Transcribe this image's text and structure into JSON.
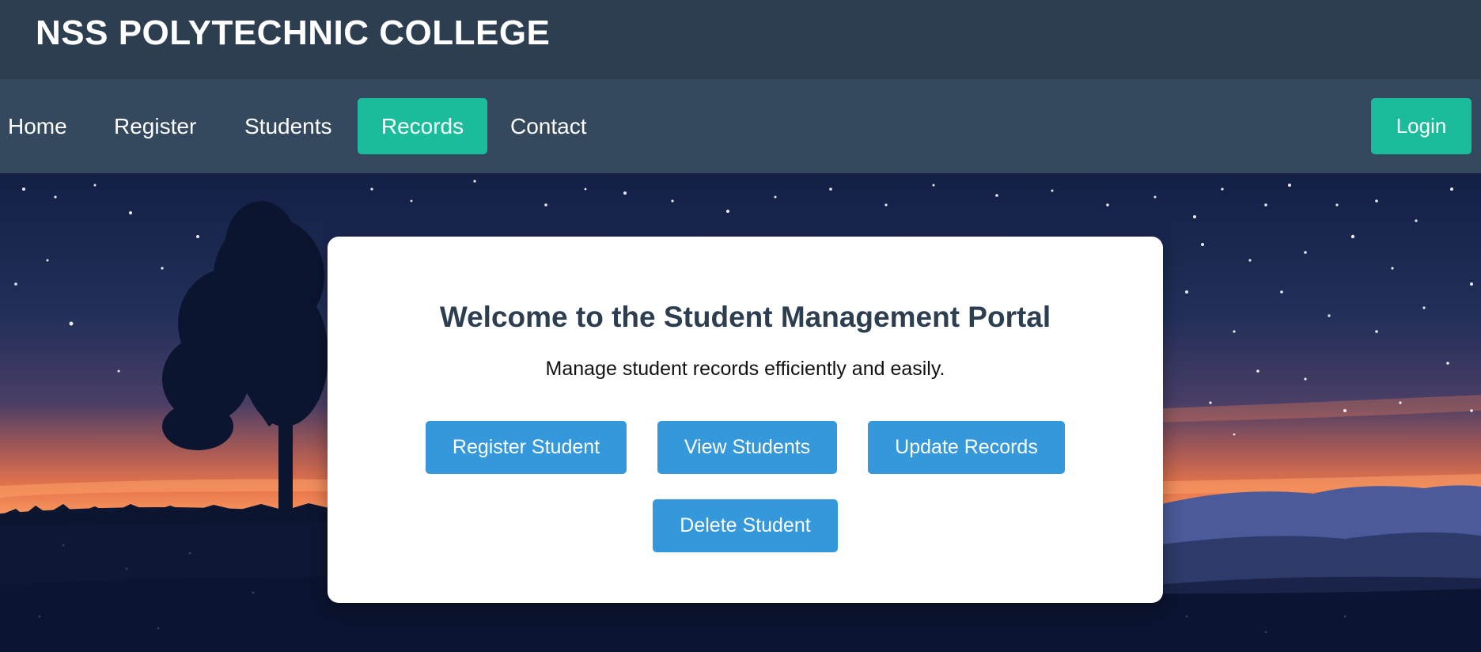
{
  "header": {
    "title": "NSS POLYTECHNIC COLLEGE"
  },
  "nav": {
    "items": [
      {
        "label": "Home"
      },
      {
        "label": "Register"
      },
      {
        "label": "Students"
      },
      {
        "label": "Records",
        "active": true
      },
      {
        "label": "Contact"
      }
    ],
    "login_label": "Login"
  },
  "hero": {
    "title": "Welcome to the Student Management Portal",
    "subtitle": "Manage student records efficiently and easily.",
    "buttons": [
      {
        "label": "Register Student"
      },
      {
        "label": "View Students"
      },
      {
        "label": "Update Records"
      },
      {
        "label": "Delete Student"
      }
    ]
  },
  "colors": {
    "header_bg": "#2c3e50",
    "nav_bg": "#34495e",
    "accent": "#1abc9c",
    "button": "#3498db",
    "title_text": "#2c3e50"
  }
}
